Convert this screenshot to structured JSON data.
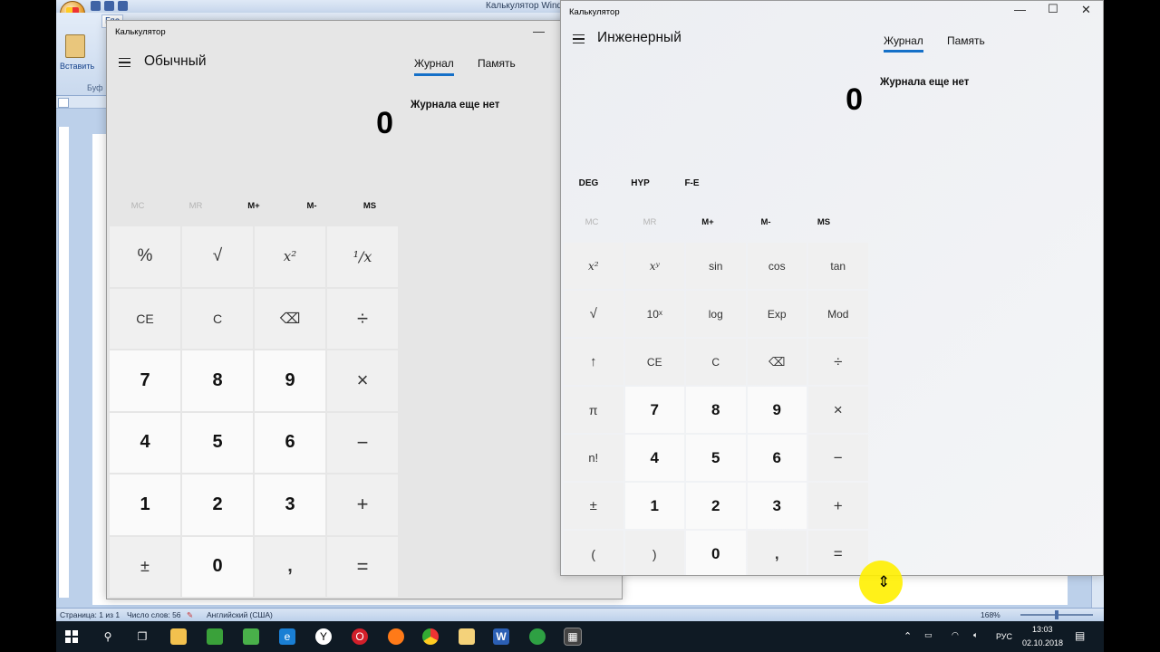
{
  "word": {
    "window_title": "Калькулятор Windo",
    "ribbon_tab": "Гла",
    "paste_label": "Вставить",
    "clipboard_group": "Буф",
    "status": {
      "page": "Страница: 1 из 1",
      "words": "Число слов: 56",
      "language": "Английский (США)",
      "zoom": "168%"
    }
  },
  "calc_standard": {
    "window_title": "Калькулятор",
    "mode": "Обычный",
    "tabs": [
      "Журнал",
      "Память"
    ],
    "history_empty": "Журнала еще нет",
    "display": "0",
    "memory": [
      "MC",
      "MR",
      "M+",
      "M-",
      "MS"
    ],
    "keys": [
      "%",
      "√",
      "x²",
      "¹/x",
      "CE",
      "C",
      "⌫",
      "÷",
      "7",
      "8",
      "9",
      "×",
      "4",
      "5",
      "6",
      "−",
      "1",
      "2",
      "3",
      "+",
      "±",
      "0",
      ",",
      "="
    ],
    "minimize": "—"
  },
  "calc_scientific": {
    "window_title": "Калькулятор",
    "mode": "Инженерный",
    "tabs": [
      "Журнал",
      "Память"
    ],
    "history_empty": "Журнала еще нет",
    "display": "0",
    "angle_row": [
      "DEG",
      "HYP",
      "F-E"
    ],
    "memory": [
      "MC",
      "MR",
      "M+",
      "M-",
      "MS"
    ],
    "keys": [
      "x²",
      "xʸ",
      "sin",
      "cos",
      "tan",
      "√",
      "10ˣ",
      "log",
      "Exp",
      "Mod",
      "↑",
      "CE",
      "C",
      "⌫",
      "÷",
      "π",
      "7",
      "8",
      "9",
      "×",
      "n!",
      "4",
      "5",
      "6",
      "−",
      "±",
      "1",
      "2",
      "3",
      "+",
      "(",
      ")",
      "0",
      ",",
      "="
    ],
    "controls": {
      "minimize": "—",
      "maximize": "☐",
      "close": "✕"
    }
  },
  "taskbar": {
    "language": "РУС",
    "time": "13:03",
    "date": "02.10.2018"
  }
}
